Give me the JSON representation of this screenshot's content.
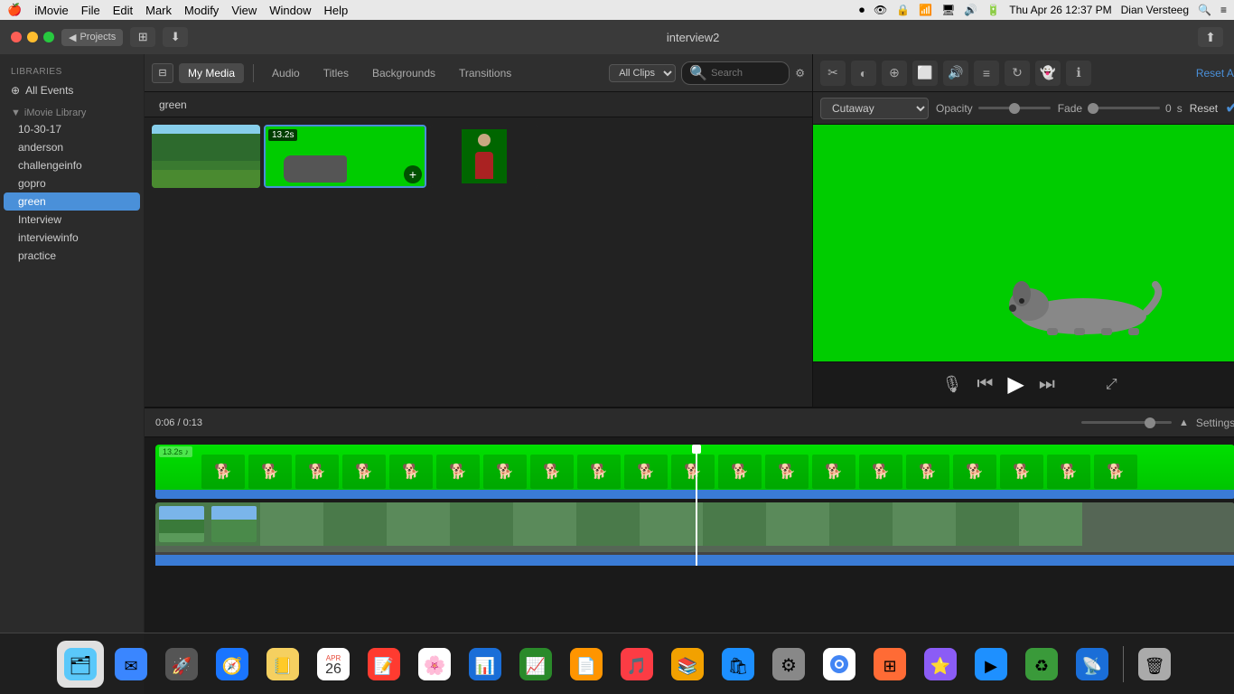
{
  "menubar": {
    "apple": "🍎",
    "imovie": "iMovie",
    "items": [
      "File",
      "Edit",
      "Mark",
      "Modify",
      "View",
      "Window",
      "Help"
    ],
    "time": "Thu Apr 26  12:37 PM",
    "user": "Dian Versteeg"
  },
  "titlebar": {
    "title": "interview2",
    "projects_btn": "Projects",
    "back_icon": "◀",
    "down_icon": "⬇",
    "share_icon": "⬆"
  },
  "sidebar": {
    "libraries_label": "LIBRARIES",
    "all_events_label": "All Events",
    "library_label": "iMovie Library",
    "items": [
      {
        "label": "10-30-17"
      },
      {
        "label": "anderson"
      },
      {
        "label": "challengeinfo"
      },
      {
        "label": "gopro"
      },
      {
        "label": "green",
        "active": true
      },
      {
        "label": "Interview"
      },
      {
        "label": "interviewinfo"
      },
      {
        "label": "practice"
      }
    ]
  },
  "media": {
    "tabs": [
      "My Media",
      "Audio",
      "Titles",
      "Backgrounds",
      "Transitions"
    ],
    "active_tab": "My Media",
    "folder": "green",
    "clips_label": "All Clips",
    "search_placeholder": "Search",
    "clips": [
      {
        "type": "park",
        "duration": null
      },
      {
        "type": "green",
        "duration": "13.2s",
        "selected": true
      },
      {
        "type": "person",
        "duration": null
      }
    ]
  },
  "inspector": {
    "reset_all": "Reset All",
    "cutaway_label": "Cutaway",
    "opacity_label": "Opacity",
    "fade_label": "Fade",
    "fade_value": "0",
    "fade_unit": "s",
    "reset_label": "Reset",
    "icons": [
      "✂",
      "◐",
      "⊕",
      "⬜",
      "🎵",
      "≡",
      "↻",
      "👻",
      "ℹ"
    ]
  },
  "player": {
    "timecode": "0:06",
    "duration": "0:13"
  },
  "timeline": {
    "settings_label": "Settings",
    "tracks": [
      {
        "type": "green",
        "label": "13.2s",
        "color": "#00d000"
      },
      {
        "type": "park",
        "color": "#5a8a50"
      }
    ]
  },
  "dock": {
    "icons": [
      {
        "name": "finder",
        "emoji": "🗂",
        "bg": "#5ac8fa"
      },
      {
        "name": "mail",
        "emoji": "✉",
        "bg": "#3a86ff"
      },
      {
        "name": "launchpad",
        "emoji": "🚀",
        "bg": "#333"
      },
      {
        "name": "safari",
        "emoji": "🧭",
        "bg": "#1a75ff"
      },
      {
        "name": "notes",
        "emoji": "📒",
        "bg": "#f5d060"
      },
      {
        "name": "calendar",
        "emoji": "📅",
        "bg": "#fff"
      },
      {
        "name": "reminders",
        "emoji": "📝",
        "bg": "#ff3b30"
      },
      {
        "name": "photos",
        "emoji": "🌸",
        "bg": "#fff"
      },
      {
        "name": "keynote",
        "emoji": "📊",
        "bg": "#1a6ed8"
      },
      {
        "name": "numbers",
        "emoji": "📈",
        "bg": "#2a8a2a"
      },
      {
        "name": "pages",
        "emoji": "📄",
        "bg": "#ff9500"
      },
      {
        "name": "music",
        "emoji": "🎵",
        "bg": "#fc3c44"
      },
      {
        "name": "books",
        "emoji": "📚",
        "bg": "#f2a100"
      },
      {
        "name": "appstore",
        "emoji": "🛍",
        "bg": "#1c8fff"
      },
      {
        "name": "prefs",
        "emoji": "⚙",
        "bg": "#888"
      },
      {
        "name": "chrome",
        "emoji": "🌐",
        "bg": "#fff"
      },
      {
        "name": "mosaic",
        "emoji": "⊞",
        "bg": "#ff6b35"
      },
      {
        "name": "imovie",
        "emoji": "🎬",
        "bg": "#8b5cf6"
      },
      {
        "name": "quicktime",
        "emoji": "▶",
        "bg": "#1e90ff"
      },
      {
        "name": "recycle",
        "emoji": "♻",
        "bg": "#3a3"
      },
      {
        "name": "airdrop",
        "emoji": "📡",
        "bg": "#1a6ed8"
      },
      {
        "name": "trash",
        "emoji": "🗑",
        "bg": "#888"
      }
    ]
  }
}
